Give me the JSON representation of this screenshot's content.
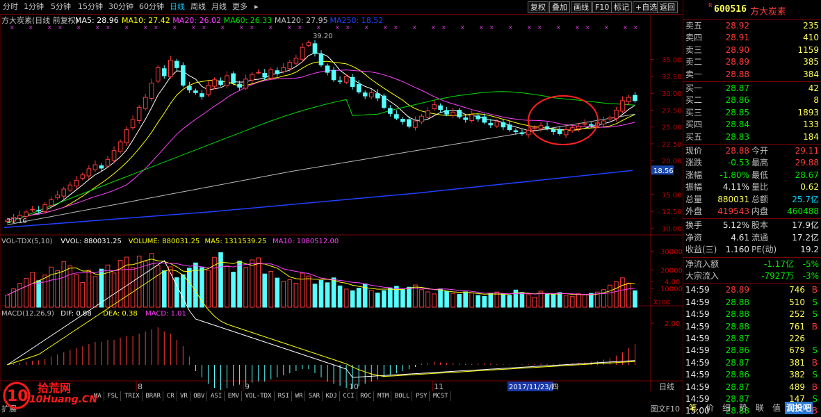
{
  "toolbar": {
    "periods": [
      "分时",
      "1分钟",
      "5分钟",
      "15分钟",
      "30分钟",
      "60分钟",
      "日线",
      "周线",
      "月线",
      "更多"
    ],
    "active_period": "日线",
    "periods_suffix": "▸",
    "right_buttons": [
      "复权",
      "叠加",
      "画线",
      "F10",
      "标记",
      "+自选",
      "返回"
    ]
  },
  "chart": {
    "stock_title": "方大炭素(日线 前复权)",
    "ma_legend": [
      {
        "label": "MA5: 28.96",
        "color": "#ffffff"
      },
      {
        "label": "MA10: 27.42",
        "color": "#ffff00"
      },
      {
        "label": "MA20: 26.02",
        "color": "#ff40ff"
      },
      {
        "label": "MA60: 26.33",
        "color": "#00e000"
      },
      {
        "label": "MA120: 27.95",
        "color": "#c0c0c0"
      },
      {
        "label": "MA250: 18.52",
        "color": "#2040ff"
      }
    ],
    "price_axis": [
      "35.00",
      "32.50",
      "30.00",
      "27.50",
      "25.00",
      "22.50",
      "20.00",
      "15.00",
      "12.50",
      "10.00"
    ],
    "current_price_tag": "18.56",
    "high_label": "39.20",
    "low_label": "11.16",
    "vol_legend": [
      {
        "label": "VOL-TDX(5,10)",
        "color": "#c0c0c0"
      },
      {
        "label": "VVOL: 880031.25",
        "color": "#ffffff"
      },
      {
        "label": "VOLUME: 880031.25",
        "color": "#ffff00"
      },
      {
        "label": "MA5: 1311539.25",
        "color": "#ffff00"
      },
      {
        "label": "MA10: 1080512.00",
        "color": "#ff40ff"
      }
    ],
    "vol_axis": [
      "30000",
      "20000",
      "10000"
    ],
    "vol_unit": "X100",
    "macd_legend": [
      {
        "label": "MACD(12,26,9)",
        "color": "#c0c0c0"
      },
      {
        "label": "DIF: 0.88",
        "color": "#ffffff"
      },
      {
        "label": "DEA: 0.38",
        "color": "#ffff00"
      },
      {
        "label": "MACD: 1.01",
        "color": "#ff40ff"
      }
    ],
    "macd_axis": [
      "4.00",
      "2.00"
    ],
    "months": [
      "8",
      "9",
      "10",
      "11"
    ],
    "cursor_date": "2017/11/23/四",
    "axis_period": "日线"
  },
  "indicators": [
    "MA",
    "FSL",
    "TRIX",
    "BRAR",
    "CR",
    "VR",
    "OBV",
    "ASI",
    "EMV",
    "VOL-TDX",
    "RSI",
    "WR",
    "SAR",
    "KDJ",
    "CCI",
    "ROC",
    "MTM",
    "BOLL",
    "PSY",
    "MCST"
  ],
  "bottom": {
    "watermark_cn": "拾荒网",
    "watermark_en": "10Huang.CN",
    "tools": "扩展",
    "f10": "图文F10"
  },
  "panel": {
    "code": "600516",
    "name": "方大炭素",
    "flag": "R",
    "asks": [
      {
        "label": "卖五",
        "price": "28.92",
        "vol": "235"
      },
      {
        "label": "卖四",
        "price": "28.91",
        "vol": "410"
      },
      {
        "label": "卖三",
        "price": "28.90",
        "vol": "1159"
      },
      {
        "label": "卖二",
        "price": "28.89",
        "vol": "385"
      },
      {
        "label": "卖一",
        "price": "28.88",
        "vol": "384"
      }
    ],
    "bids": [
      {
        "label": "买一",
        "price": "28.87",
        "vol": "42"
      },
      {
        "label": "买二",
        "price": "28.86",
        "vol": "8"
      },
      {
        "label": "买三",
        "price": "28.85",
        "vol": "1893"
      },
      {
        "label": "买四",
        "price": "28.84",
        "vol": "133"
      },
      {
        "label": "买五",
        "price": "28.83",
        "vol": "184"
      }
    ],
    "stats": [
      {
        "l1": "现价",
        "v1": "28.88",
        "c1": "red",
        "l2": "今开",
        "v2": "29.11",
        "c2": "red"
      },
      {
        "l1": "涨跌",
        "v1": "-0.53",
        "c1": "green",
        "l2": "最高",
        "v2": "29.88",
        "c2": "red"
      },
      {
        "l1": "涨幅",
        "v1": "-1.80%",
        "c1": "green",
        "l2": "最低",
        "v2": "28.67",
        "c2": "green"
      },
      {
        "l1": "振幅",
        "v1": "4.11%",
        "c1": "white",
        "l2": "量比",
        "v2": "0.62",
        "c2": "yel"
      },
      {
        "l1": "总量",
        "v1": "880031",
        "c1": "yel",
        "l2": "总额",
        "v2": "25.7亿",
        "c2": "cyan"
      },
      {
        "l1": "外盘",
        "v1": "419543",
        "c1": "red",
        "l2": "内盘",
        "v2": "460488",
        "c2": "green"
      }
    ],
    "fundamentals": [
      {
        "l1": "换手",
        "v1": "5.12%",
        "l2": "股本",
        "v2": "17.9亿"
      },
      {
        "l1": "净资",
        "v1": "4.61",
        "l2": "流通",
        "v2": "17.2亿"
      },
      {
        "l1": "收益(三)",
        "v1": "1.160",
        "l2": "PE(动)",
        "v2": "19.2"
      }
    ],
    "flows": [
      {
        "label": "净流入额",
        "v1": "-1.17亿",
        "v2": "-5%"
      },
      {
        "label": "大宗流入",
        "v1": "-7927万",
        "v2": "-3%"
      }
    ],
    "ticks": [
      {
        "t": "14:59",
        "p": "28.89",
        "pc": "red",
        "v": "746",
        "bs": "B"
      },
      {
        "t": "14:59",
        "p": "28.88",
        "pc": "green",
        "v": "510",
        "bs": "S"
      },
      {
        "t": "14:59",
        "p": "28.88",
        "pc": "green",
        "v": "252",
        "bs": "S"
      },
      {
        "t": "14:59",
        "p": "28.88",
        "pc": "green",
        "v": "761",
        "bs": "B"
      },
      {
        "t": "14:59",
        "p": "28.87",
        "pc": "green",
        "v": "226",
        "bs": ""
      },
      {
        "t": "14:59",
        "p": "28.86",
        "pc": "green",
        "v": "679",
        "bs": "S"
      },
      {
        "t": "14:59",
        "p": "28.87",
        "pc": "green",
        "v": "381",
        "bs": "B"
      },
      {
        "t": "14:59",
        "p": "28.86",
        "pc": "green",
        "v": "382",
        "bs": "S"
      },
      {
        "t": "14:59",
        "p": "28.87",
        "pc": "green",
        "v": "489",
        "bs": "B"
      },
      {
        "t": "14:59",
        "p": "28.87",
        "pc": "green",
        "v": "147",
        "bs": "S"
      },
      {
        "t": "15:00",
        "p": "28.88",
        "pc": "green",
        "v": "128",
        "bs": "B"
      }
    ],
    "bottom_tabs": [
      "笔",
      "价",
      "细",
      "势",
      "联",
      "值"
    ],
    "brand": "润投吧"
  },
  "chart_data": {
    "type": "candlestick",
    "title": "方大炭素(日线 前复权)",
    "ylim": [
      9,
      39.5
    ],
    "closes": [
      11.2,
      11.6,
      11.9,
      12.4,
      12.8,
      12.6,
      13.5,
      14.2,
      14.9,
      15.8,
      16.4,
      17.1,
      17.9,
      18.8,
      19.4,
      18.9,
      20.2,
      21.5,
      22.8,
      24.6,
      26.1,
      27.9,
      29.4,
      31.5,
      33.8,
      32.6,
      34.9,
      33.8,
      31.2,
      30.5,
      30.1,
      29.5,
      31.2,
      32.0,
      31.3,
      32.6,
      31.5,
      30.9,
      32.1,
      32.8,
      33.1,
      32.4,
      33.5,
      32.9,
      33.8,
      34.6,
      35.2,
      36.8,
      37.5,
      35.9,
      34.2,
      33.1,
      32.0,
      31.8,
      32.5,
      31.0,
      30.2,
      29.6,
      30.1,
      29.3,
      27.9,
      27.0,
      26.3,
      25.8,
      25.1,
      25.9,
      26.6,
      27.4,
      28.3,
      27.6,
      26.9,
      27.2,
      26.5,
      26.1,
      26.8,
      26.2,
      25.7,
      25.3,
      25.8,
      25.0,
      24.6,
      24.3,
      24.0,
      24.5,
      24.9,
      25.2,
      24.8,
      24.3,
      24.0,
      24.6,
      24.9,
      25.1,
      25.5,
      25.3,
      25.6,
      25.9,
      26.4,
      27.5,
      28.9,
      29.4,
      28.9
    ],
    "volumes": [
      6500,
      9800,
      12800,
      15500,
      18600,
      14200,
      17200,
      21500,
      19600,
      24300,
      22100,
      17500,
      13200,
      19800,
      16400,
      20400,
      22600,
      18300,
      25100,
      26800,
      21200,
      27400,
      24600,
      28700,
      22300,
      19500,
      21600,
      15800,
      17400,
      20900,
      23700,
      21200,
      19800,
      26700,
      29200,
      22100,
      18800,
      24700,
      21300,
      25300,
      26400,
      17800,
      19200,
      15600,
      13900,
      14700,
      12800,
      18200,
      16700,
      12400,
      14300,
      13100,
      15700,
      11400,
      9700,
      8800,
      10200,
      12500,
      9100,
      7600,
      8900,
      10300,
      11200,
      9800,
      10700,
      11900,
      9400,
      8200,
      7100,
      9800,
      8600,
      7400,
      6900,
      8200,
      7600,
      6300,
      5800,
      7400,
      8100,
      7200,
      6400,
      9200,
      7900,
      6700,
      5400,
      8600,
      7100,
      6900,
      7800,
      6400,
      5700,
      7200,
      6600,
      7400,
      8100,
      9400,
      11800,
      13600,
      15700,
      12900,
      8800
    ],
    "macd_hist": [
      0.05,
      0.06,
      0.1,
      0.15,
      0.2,
      0.22,
      0.3,
      0.4,
      0.5,
      0.6,
      0.7,
      0.8,
      0.9,
      1.0,
      1.1,
      1.1,
      1.2,
      1.2,
      1.3,
      1.4,
      1.4,
      1.5,
      1.6,
      1.7,
      1.8,
      1.6,
      1.5,
      1.2,
      0.9,
      0.4,
      -0.3,
      -0.6,
      -0.9,
      -1.1,
      -1.2,
      -1.1,
      -1.0,
      -0.95,
      -0.9,
      -0.85,
      -0.8,
      -0.8,
      -0.7,
      -0.6,
      -0.5,
      -0.4,
      -0.3,
      -0.2,
      -0.2,
      -0.4,
      -0.6,
      -0.8,
      -0.9,
      -1.0,
      -1.1,
      -1.1,
      -1.0,
      -0.9,
      -0.8,
      -0.7,
      -0.6,
      -0.5,
      -0.4,
      -0.3,
      -0.2,
      -0.1,
      0.05,
      0.1,
      0.15,
      0.12,
      0.1,
      0.08,
      0.06,
      0.05,
      0.04,
      0.05,
      0.06,
      0.05,
      0.04,
      0.03,
      0.02,
      0.02,
      0.03,
      0.04,
      0.05,
      0.06,
      0.05,
      0.04,
      0.05,
      0.06,
      0.08,
      0.1,
      0.12,
      0.15,
      0.2,
      0.25,
      0.32,
      0.45,
      0.6,
      0.8,
      1.01
    ]
  }
}
